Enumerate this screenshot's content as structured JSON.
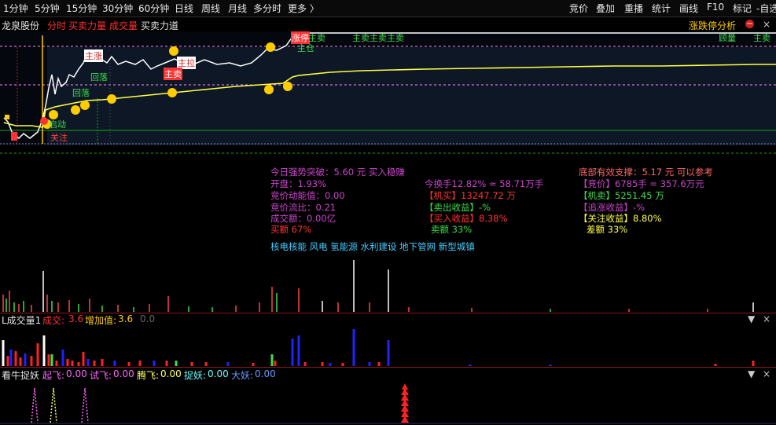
{
  "toolbar": {
    "periods": [
      "1分钟",
      "5分钟",
      "15分钟",
      "30分钟",
      "60分钟",
      "日线",
      "周线",
      "月线",
      "多分时",
      "更多 〉"
    ],
    "right": [
      "竞价",
      "叠加",
      "重播",
      "统计",
      "画线",
      "F10",
      "标记",
      "-自选"
    ]
  },
  "header": {
    "stock_name": "龙泉股份",
    "tabs": [
      "分时",
      "买卖力量",
      "成交量",
      "买卖力道"
    ],
    "right_label": "涨跌停分析",
    "colors": {
      "red": "#ff3333",
      "white": "#e6e6e6",
      "gold": "#ffcc00"
    }
  },
  "chart_labels": {
    "zhangting": "涨停",
    "zhumai_topleft": "主卖",
    "zhumai_row": "主卖主卖主卖",
    "top_right_1": "顾量",
    "top_right_2": "主卖",
    "zhucang": "主仓",
    "zhumai_mid": "主卖",
    "huiluo_1": "回落",
    "huiluo_2": "回落",
    "qidong": "启动",
    "guanzhu": "关注",
    "zhulong": "主拉",
    "zhuzhang": "主涨"
  },
  "info": {
    "col1": [
      "今日强势突破：5.60 元 买入稳赚",
      "开盘：1.93%",
      "竞价动能值：0.00",
      "竞价流比：0.21",
      "成交额：0.00亿",
      "买额 67%"
    ],
    "col2": [
      "今换手12.82%  ≈  58.71万手",
      "【机买】13247.72 万",
      "【卖出收益】-%",
      "【买入收益】8.38%",
      "卖额 33%"
    ],
    "col3": [
      "底部有效支撑：5.17 元 可以参考",
      "【竞价】6785手 = 357.6万元",
      "【机卖】5251.45 万",
      "【追涨收益】-%",
      "【关注收益】8.80%",
      "差额 33%"
    ],
    "concepts": "核电核能  风电  氢能源  水利建设  地下管网  新型城镇"
  },
  "panel1": {
    "title": "L成交量1",
    "fields": [
      {
        "label": "成交:",
        "value": "3.6"
      },
      {
        "label": "增加值:",
        "value": "3.6"
      },
      {
        "label": "",
        "value": "0.0"
      }
    ]
  },
  "panel2": {
    "title": "看牛捉妖",
    "fields": [
      {
        "label": "起飞:",
        "value": "0.00",
        "color": "#ff66ff"
      },
      {
        "label": "试飞:",
        "value": "0.00",
        "color": "#ff66ff"
      },
      {
        "label": "腾飞:",
        "value": "0.00",
        "color": "#ffff66"
      },
      {
        "label": "捉妖:",
        "value": "0.00",
        "color": "#66ffff"
      },
      {
        "label": "大妖:",
        "value": "0.00",
        "color": "#6699ff"
      }
    ]
  },
  "panel_controls": {
    "collapse": "▼",
    "close": "×"
  }
}
